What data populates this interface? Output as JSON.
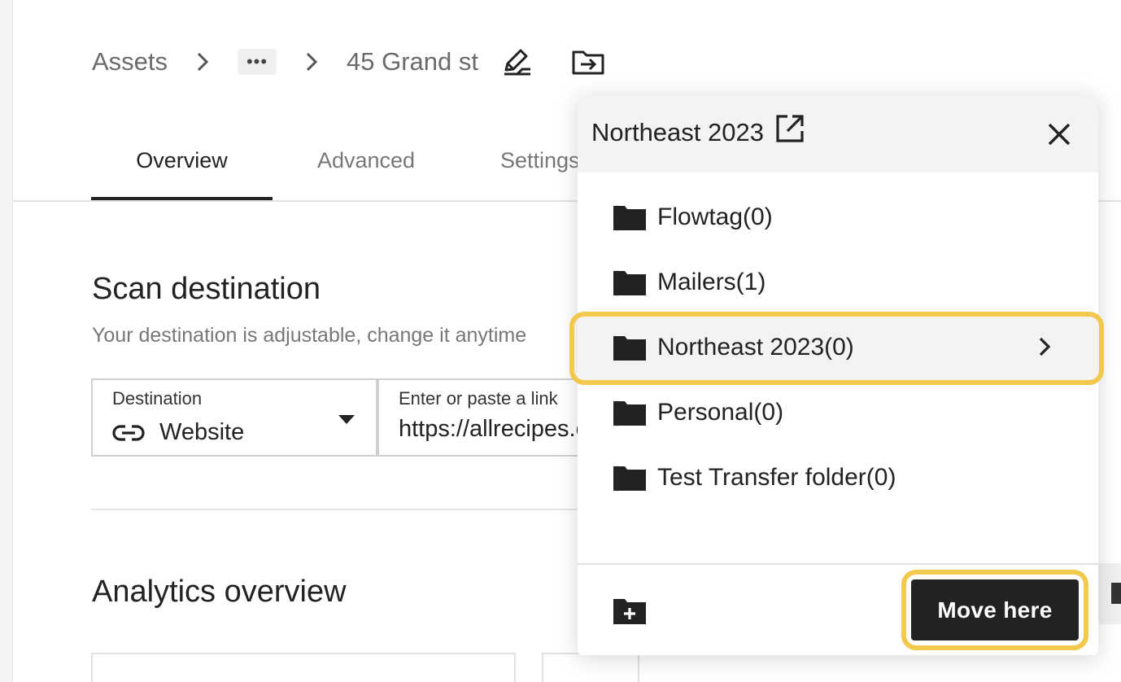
{
  "breadcrumb": {
    "root": "Assets",
    "ellipsis": "•••",
    "current": "45 Grand st",
    "separator": "›"
  },
  "tabs": [
    {
      "label": "Overview",
      "active": true
    },
    {
      "label": "Advanced",
      "active": false
    },
    {
      "label": "Settings",
      "active": false
    }
  ],
  "scan": {
    "title": "Scan destination",
    "subtitle": "Your destination is adjustable, change it anytime"
  },
  "destination": {
    "label": "Destination",
    "value": "Website",
    "icon": "link-icon"
  },
  "link_input": {
    "label": "Enter or paste a link",
    "value": "https://allrecipes.com"
  },
  "analytics": {
    "title": "Analytics overview"
  },
  "modal": {
    "title": "Northeast 2023",
    "folders": [
      {
        "label": "Flowtag(0)",
        "selected": false
      },
      {
        "label": "Mailers(1)",
        "selected": false
      },
      {
        "label": "Northeast 2023(0)",
        "selected": true
      },
      {
        "label": "Personal(0)",
        "selected": false
      },
      {
        "label": "Test Transfer folder(0)",
        "selected": false
      }
    ],
    "move_label": "Move here"
  },
  "colors": {
    "highlight": "#f2c94c",
    "primary_button": "#222222",
    "header_bg": "#f4f3f1"
  }
}
